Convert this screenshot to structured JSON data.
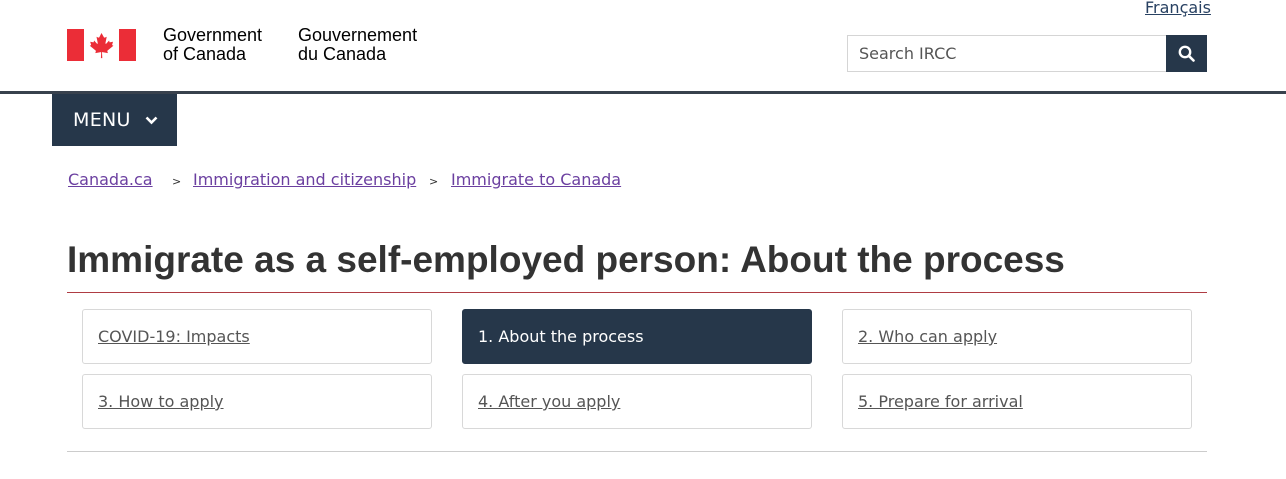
{
  "header": {
    "language_link": "Français",
    "signature_en_line1": "Government",
    "signature_en_line2": "of Canada",
    "signature_fr_line1": "Gouvernement",
    "signature_fr_line2": "du Canada",
    "search": {
      "placeholder": "Search IRCC"
    },
    "menu_label": "MENU",
    "colors": {
      "brand_dark": "#26374a",
      "flag_red": "#eb2d37"
    }
  },
  "breadcrumb": [
    {
      "label": "Canada.ca"
    },
    {
      "label": "Immigration and citizenship"
    },
    {
      "label": "Immigrate to Canada"
    }
  ],
  "breadcrumb_separator": ">",
  "page": {
    "title": "Immigrate as a self-employed person: About the process"
  },
  "steps": [
    {
      "label": "COVID-19: Impacts",
      "active": false
    },
    {
      "label": "1. About the process",
      "active": true
    },
    {
      "label": "2. Who can apply",
      "active": false
    },
    {
      "label": "3. How to apply",
      "active": false
    },
    {
      "label": "4. After you apply",
      "active": false
    },
    {
      "label": "5. Prepare for arrival",
      "active": false
    }
  ]
}
